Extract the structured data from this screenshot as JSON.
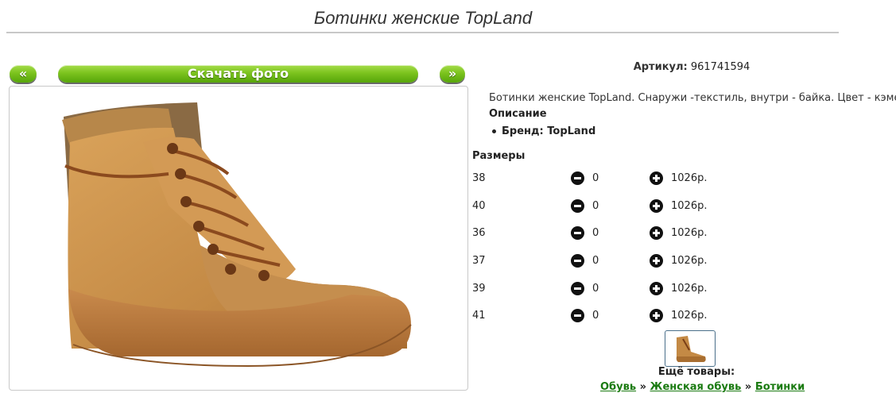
{
  "page": {
    "title": "Ботинки женские TopLand"
  },
  "gallery": {
    "prev_label": "«",
    "download_label": "Скачать фото",
    "next_label": "»"
  },
  "product": {
    "article_label": "Артикул:",
    "article_value": "961741594",
    "description": "Ботинки женские TopLand. Снаружи -текстиль, внутри - байка. Цвет - кэмел.",
    "description_heading": "Описание",
    "brand_label": "Бренд:",
    "brand_value": "TopLand"
  },
  "sizes": {
    "heading": "Размеры",
    "rows": [
      {
        "size": "38",
        "qty": "0",
        "price": "1026р."
      },
      {
        "size": "40",
        "qty": "0",
        "price": "1026р."
      },
      {
        "size": "36",
        "qty": "0",
        "price": "1026р."
      },
      {
        "size": "37",
        "qty": "0",
        "price": "1026р."
      },
      {
        "size": "39",
        "qty": "0",
        "price": "1026р."
      },
      {
        "size": "41",
        "qty": "0",
        "price": "1026р."
      }
    ]
  },
  "more": {
    "label": "Ещё товары:",
    "breadcrumbs": [
      "Обувь",
      "Женская обувь",
      "Ботинки"
    ],
    "separator": "»"
  },
  "colors": {
    "button_green": "#7cc31e",
    "link_green": "#1b7b12",
    "boot_camel": "#c48a45"
  }
}
